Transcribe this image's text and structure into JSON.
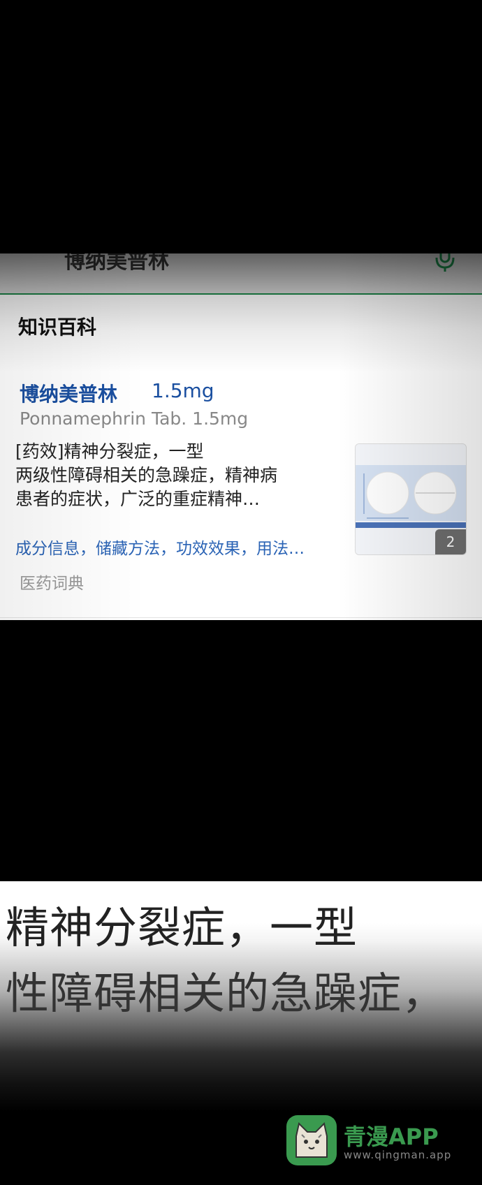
{
  "search": {
    "query": "博纳美普林"
  },
  "section": {
    "title": "知识百科"
  },
  "entry": {
    "name": "博纳美普林",
    "dose": "1.5mg",
    "english_name": "Ponnamephrin Tab. 1.5mg",
    "description_lines": [
      "[药效]精神分裂症，一型",
      "两级性障碍相关的急躁症，精神病",
      "患者的症状，广泛的重症精神…"
    ],
    "links": "成分信息，储藏方法，功效效果，用法…",
    "source": "医药词典",
    "image_count": "2"
  },
  "caption": {
    "line1": "精神分裂症，一型",
    "line2": "性障碍相关的急躁症，"
  },
  "watermark": {
    "title": "青漫APP",
    "url": "www.qingman.app"
  },
  "colors": {
    "link_blue": "#1a4fa0",
    "accent_green": "#1d8a4a",
    "watermark_green": "#3a9a4f"
  }
}
